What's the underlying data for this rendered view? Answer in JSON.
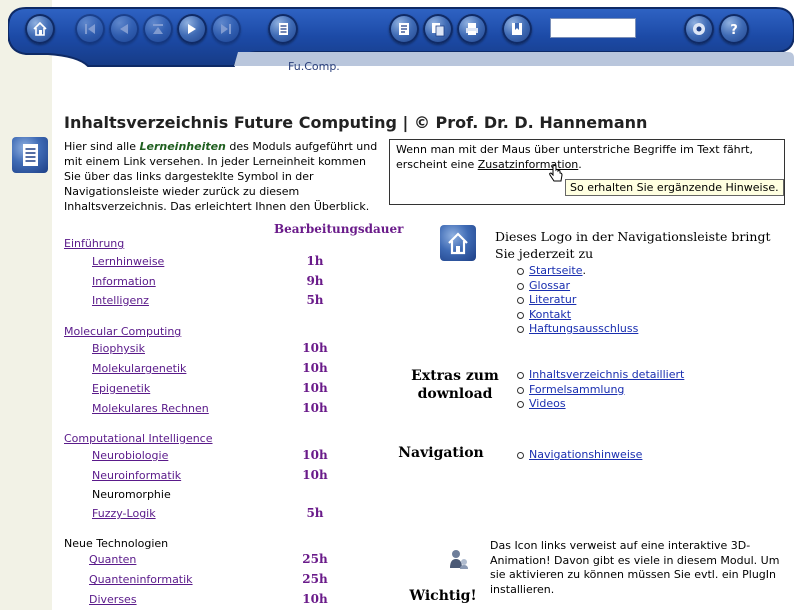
{
  "navbar": {
    "breadcrumb": "Fu.Comp.",
    "search_value": "",
    "icons": [
      "home-icon",
      "first-page-icon",
      "previous-page-icon",
      "up-icon",
      "next-page-icon",
      "last-page-icon",
      "contents-list-icon",
      "notes-icon",
      "glossary-icon",
      "print-icon",
      "bookmark-icon",
      "module-map-icon",
      "help-icon"
    ]
  },
  "page": {
    "title": "Inhaltsverzeichnis Future Computing | © Prof. Dr. D. Hannemann",
    "intro_before": "Hier sind alle ",
    "intro_em": "Lerneinheiten",
    "intro_after": " des Moduls aufgeführt und mit einem Link versehen. In jeder Lerneinheit kommen Sie über das links dargesteklte Symbol in der Navigationsleiste wieder zurück zu diesem Inhaltsverzeichnis. Das erleichtert Ihnen den Überblick.",
    "hint_before": "Wenn man mit der Maus über unterstriche Begriffe im Text fährt, erscheint eine ",
    "hint_link": "Zusatzinformation",
    "hint_after": ".",
    "tooltip": "So erhalten Sie ergänzende Hinweise."
  },
  "toc": {
    "duration_header": "Bearbeitungsdauer",
    "sections": [
      {
        "title": "Einführung",
        "items": [
          {
            "label": "Lernhinweise",
            "duration": "1h"
          },
          {
            "label": "Information",
            "duration": "9h"
          },
          {
            "label": "Intelligenz",
            "duration": "5h"
          }
        ]
      },
      {
        "title": "Molecular Computing",
        "items": [
          {
            "label": "Biophysik",
            "duration": "10h"
          },
          {
            "label": "Molekulargenetik",
            "duration": "10h"
          },
          {
            "label": "Epigenetik",
            "duration": "10h"
          },
          {
            "label": "Molekulares Rechnen",
            "duration": "10h"
          }
        ]
      },
      {
        "title": "Computational Intelligence",
        "items": [
          {
            "label": "Neurobiologie",
            "duration": "10h"
          },
          {
            "label": "Neuroinformatik",
            "duration": "10h"
          },
          {
            "label": "Neuromorphie",
            "duration": ""
          },
          {
            "label": "Fuzzy-Logik",
            "duration": "5h"
          }
        ]
      },
      {
        "title": "Neue Technologien",
        "items": [
          {
            "label": "Quanten",
            "duration": "25h"
          },
          {
            "label": "Quanteninformatik",
            "duration": "25h"
          },
          {
            "label": "Diverses",
            "duration": "10h"
          }
        ]
      }
    ]
  },
  "right": {
    "logo_text": "Dieses Logo in der Navigationsleiste bringt Sie jederzeit zu",
    "logo_links": [
      "Startseite",
      "Glossar",
      "Literatur",
      "Kontakt",
      "Haftungsausschluss"
    ],
    "logo_links_suffix": ".",
    "extras_heading": "Extras zum download",
    "extras_links": [
      "Inhaltsverzeichnis detailliert",
      "Formelsammlung",
      "Videos"
    ],
    "navigation_heading": "Navigation",
    "navigation_links": [
      "Navigationshinweise"
    ],
    "anim_text": "Das Icon links verweist auf eine interaktive 3D-Animation! Davon gibt es viele in diesem Modul. Um sie aktivieren zu können müssen Sie evtl. ein PlugIn installieren.",
    "wichtig_heading": "Wichtig!"
  }
}
